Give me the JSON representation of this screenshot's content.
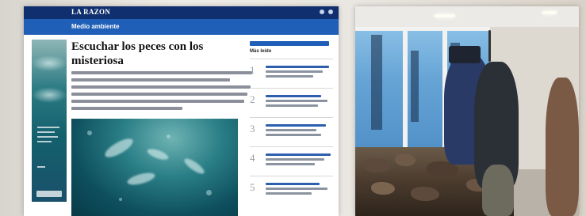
{
  "article": {
    "brand": "LA RAZON",
    "section": "Medio ambiente",
    "headline": "Escuchar los peces con los misteriosa",
    "ranking_title": "Más leído",
    "ranking_numbers": [
      "1",
      "2",
      "3",
      "4",
      "5"
    ]
  },
  "colors": {
    "topbar": "#0f2f6e",
    "section_bar": "#1f5fb8",
    "ocean": "#0e4f5e"
  }
}
